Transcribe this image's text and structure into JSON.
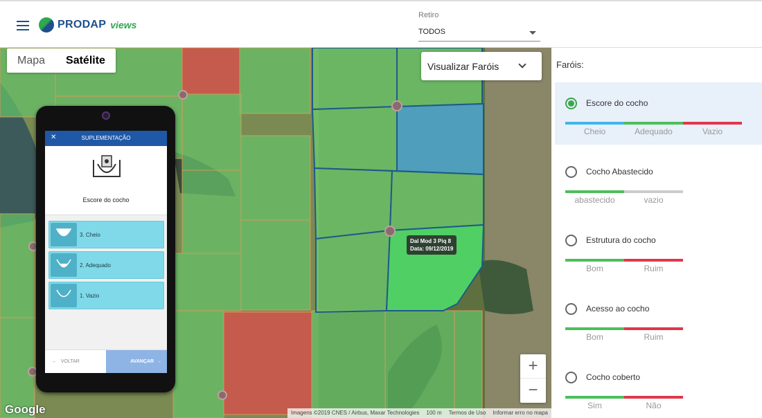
{
  "header": {
    "menu_icon": "hamburger-icon",
    "brand": "PRODAP",
    "brand_sub": "views",
    "retiro_label": "Retiro",
    "retiro_value": "TODOS"
  },
  "map": {
    "type_buttons": [
      "Mapa",
      "Satélite"
    ],
    "active_type": "Satélite",
    "farois_select": "Visualizar Faróis",
    "tooltip_line1": "Dal Mod 3 Piq 8",
    "tooltip_line2": "Data: 09/12/2019",
    "zoom_in": "+",
    "zoom_out": "−",
    "google": "Google",
    "attribution": [
      "Imagens ©2019 CNES / Airbus, Maxar Technologies",
      "100 m",
      "Termos de Uso",
      "Informar erro no mapa"
    ]
  },
  "phone": {
    "header_title": "SUPLEMENTAÇÃO",
    "close": "✕",
    "question": "Escore do cocho",
    "options": [
      "3. Cheio",
      "2. Adequado",
      "1. Vazio"
    ],
    "back": "VOLTAR",
    "next": "AVANÇAR"
  },
  "panel": {
    "title": "Faróis:",
    "items": [
      {
        "label": "Escore do cocho",
        "selected": true,
        "scale": [
          "Cheio",
          "Adequado",
          "Vazio"
        ],
        "colors": [
          "#3fb7e8",
          "#4cbf5b",
          "#e0374b"
        ]
      },
      {
        "label": "Cocho Abastecido",
        "selected": false,
        "scale": [
          "abastecido",
          "vazio"
        ],
        "colors": [
          "#4cbf5b",
          "#cccccc"
        ]
      },
      {
        "label": "Estrutura do cocho",
        "selected": false,
        "scale": [
          "Bom",
          "Ruim"
        ],
        "colors": [
          "#4cbf5b",
          "#e0374b"
        ]
      },
      {
        "label": "Acesso ao cocho",
        "selected": false,
        "scale": [
          "Bom",
          "Ruim"
        ],
        "colors": [
          "#4cbf5b",
          "#e0374b"
        ]
      },
      {
        "label": "Cocho coberto",
        "selected": false,
        "scale": [
          "Sim",
          "Não"
        ],
        "colors": [
          "#4cbf5b",
          "#e0374b"
        ]
      }
    ]
  }
}
